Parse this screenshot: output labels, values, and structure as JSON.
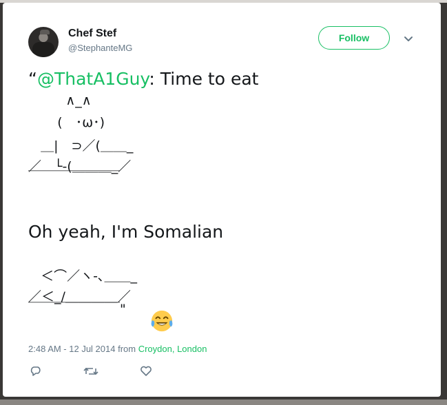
{
  "author": {
    "display_name": "Chef Stef",
    "handle": "@StephanteMG"
  },
  "follow_button": {
    "label": "Follow"
  },
  "tweet": {
    "open_quote": "“",
    "mention": "@ThatA1Guy",
    "after_mention": ": Time to eat",
    "art_block_1": [
      "         ∧_∧",
      "       (　･ω･)",
      "   ＿|　⊃／(＿＿_",
      "／　└-(＿＿＿_／",
      "￣￣￣￣￣￣￣"
    ],
    "line_2": "Oh yeah, I'm Somalian",
    "art_block_2": [
      "   ＜⌒／ヽ-､＿＿_",
      "／＜_/＿＿＿＿／",
      "￣￣￣￣￣￣￣\""
    ]
  },
  "meta": {
    "time": "2:48 AM - 12 Jul 2014 from ",
    "location": "Croydon, London"
  },
  "icons": {
    "reply": "reply-icon",
    "retweet": "retweet-icon",
    "like": "heart-icon",
    "more": "chevron-down-icon",
    "emoji": "face-with-tears-of-joy-icon"
  },
  "colors": {
    "accent": "#17bf63",
    "text": "#14171a",
    "muted": "#657786"
  }
}
